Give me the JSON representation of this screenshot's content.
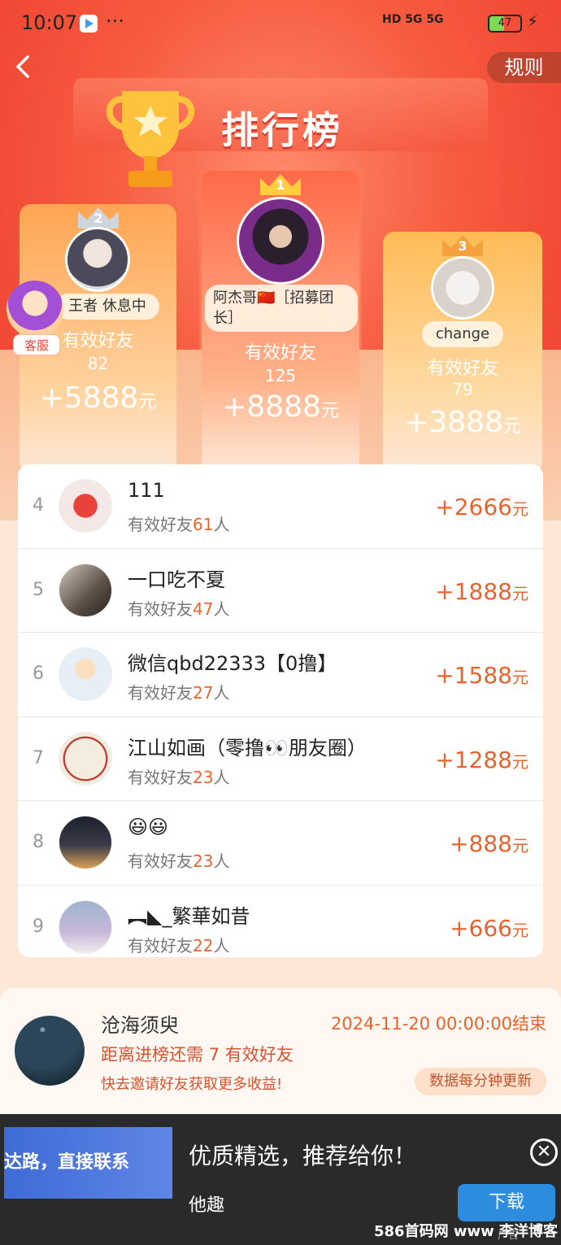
{
  "status_bar": {
    "time": "10:07",
    "dots": "···",
    "signal": "HD 5G 5G",
    "battery": "47"
  },
  "header": {
    "back_icon": "chevron-left-icon",
    "rules_label": "规则",
    "title": "排行榜"
  },
  "customer_service": {
    "label": "客服"
  },
  "podium": {
    "first": {
      "rank": "1",
      "name": "阿杰哥🇨🇳［招募团长］",
      "label": "有效好友",
      "count": "125",
      "amount": "+8888",
      "unit": "元"
    },
    "second": {
      "rank": "2",
      "name": "王者  休息中",
      "label": "有效好友",
      "count": "82",
      "amount": "+5888",
      "unit": "元"
    },
    "third": {
      "rank": "3",
      "name": "change",
      "label": "有效好友",
      "count": "79",
      "amount": "+3888",
      "unit": "元"
    }
  },
  "list": {
    "label_prefix": "有效好友",
    "label_suffix": "人",
    "unit": "元",
    "rows": [
      {
        "rank": "4",
        "name": "111",
        "count": "61",
        "amount": "+2666"
      },
      {
        "rank": "5",
        "name": "一口吃不夏",
        "count": "47",
        "amount": "+1888"
      },
      {
        "rank": "6",
        "name": "微信qbd22333【0撸】",
        "count": "27",
        "amount": "+1588"
      },
      {
        "rank": "7",
        "name": "江山如画（零撸👀朋友圈）",
        "count": "23",
        "amount": "+1288"
      },
      {
        "rank": "8",
        "name": "😃😃",
        "count": "23",
        "amount": "+888"
      },
      {
        "rank": "9",
        "name": "︻◣_繁華如昔",
        "count": "22",
        "amount": "+666"
      }
    ]
  },
  "my_card": {
    "name": "沧海须臾",
    "deadline": "2024-11-20 00:00:00结束",
    "need_prefix": "距离进榜还需 ",
    "need_count": "7",
    "need_suffix": " 有效好友",
    "invite": "快去邀请好友获取更多收益!",
    "update": "数据每分钟更新"
  },
  "ad": {
    "image_text": "达路，直接联系",
    "title": "优质精选，推荐给你！",
    "source": "他趣",
    "download": "下载",
    "ad_label": "广告",
    "close_icon": "close-icon",
    "watermark": "586首码网 www 李洋博客"
  },
  "colors": {
    "accent": "#e8642f",
    "hero_red": "#ee3b2d",
    "gold": "#ffb43a",
    "download_blue": "#2b8ce0"
  }
}
